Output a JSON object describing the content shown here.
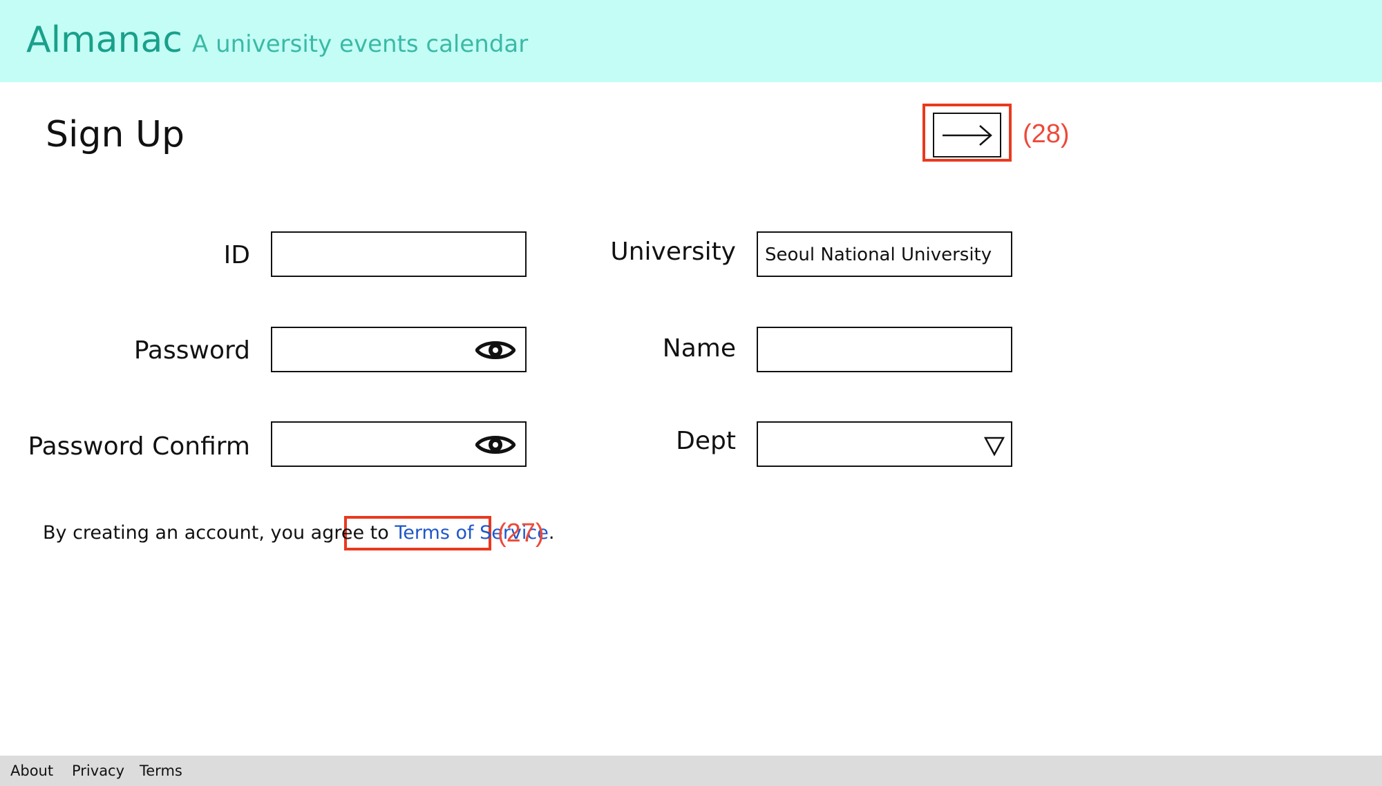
{
  "header": {
    "brand": "Almanac",
    "tagline": "A university events calendar"
  },
  "page": {
    "title": "Sign Up"
  },
  "next_button": {
    "icon": "arrow-right-icon",
    "annotation": "(28)"
  },
  "form": {
    "id": {
      "label": "ID",
      "value": ""
    },
    "password": {
      "label": "Password",
      "value": "",
      "icon": "eye-icon"
    },
    "password_confirm": {
      "label": "Password Confirm",
      "value": "",
      "icon": "eye-icon"
    },
    "university": {
      "label": "University",
      "value": "Seoul National University"
    },
    "name": {
      "label": "Name",
      "value": ""
    },
    "dept": {
      "label": "Dept",
      "value": "",
      "icon": "dropdown-triangle-icon"
    }
  },
  "agreement": {
    "text": "By creating an account, you agree to",
    "link_text": "Terms of Service",
    "trailing": ".",
    "annotation": "(27)"
  },
  "footer": {
    "links": [
      "About",
      "Privacy",
      "Terms"
    ]
  },
  "colors": {
    "header_bg": "#c4fdf6",
    "brand": "#19a08a",
    "tagline": "#3bb9a6",
    "link": "#1f56c8",
    "annotation": "#ec4a3a",
    "footer_bg": "#dcdcdc"
  }
}
